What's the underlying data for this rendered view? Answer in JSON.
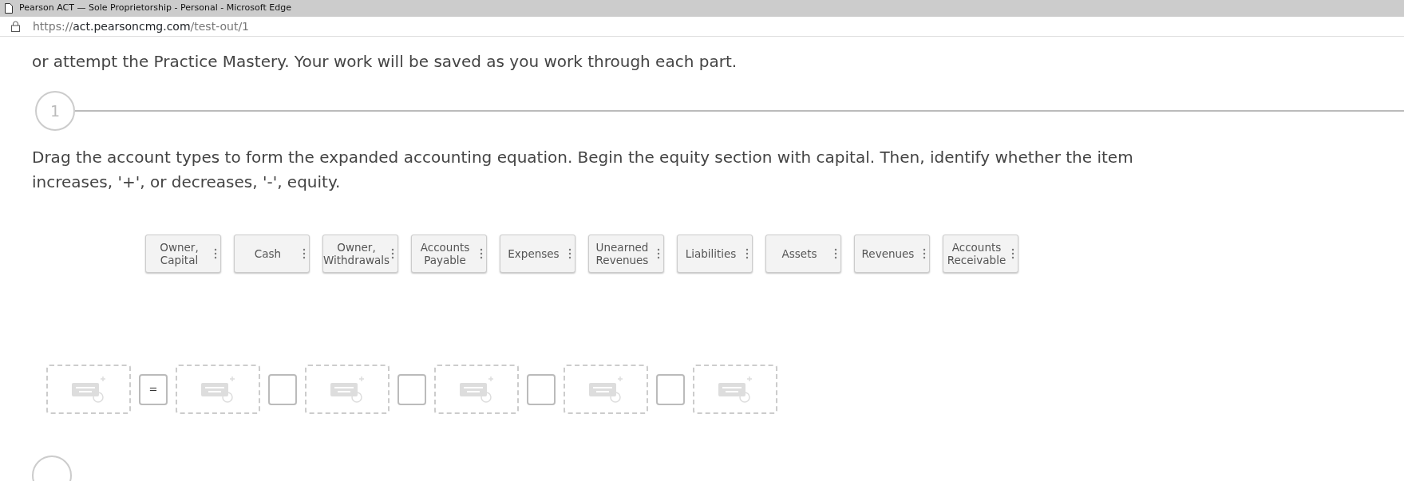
{
  "window": {
    "title": "Pearson ACT — Sole Proprietorship - Personal - Microsoft Edge"
  },
  "address_bar": {
    "scheme": "https://",
    "host": "act.pearsoncmg.com",
    "path": "/test-out/1"
  },
  "intro": "or attempt the Practice Mastery. Your work will be saved as you work through each part.",
  "step": {
    "number": "1",
    "question": "Drag the account types to form the expanded accounting equation. Begin the equity section with capital. Then, identify whether the item increases, '+', or decreases, '-', equity."
  },
  "choices": [
    {
      "label": "Owner, Capital"
    },
    {
      "label": "Cash"
    },
    {
      "label": "Owner, Withdrawals"
    },
    {
      "label": "Accounts Payable"
    },
    {
      "label": "Expenses"
    },
    {
      "label": "Unearned Revenues"
    },
    {
      "label": "Liabilities"
    },
    {
      "label": "Assets"
    },
    {
      "label": "Revenues"
    },
    {
      "label": "Accounts Receivable"
    }
  ],
  "equation": [
    {
      "kind": "drop"
    },
    {
      "kind": "operator",
      "value": "="
    },
    {
      "kind": "drop"
    },
    {
      "kind": "operator"
    },
    {
      "kind": "drop"
    },
    {
      "kind": "operator"
    },
    {
      "kind": "drop"
    },
    {
      "kind": "operator"
    },
    {
      "kind": "drop"
    },
    {
      "kind": "operator"
    },
    {
      "kind": "drop"
    }
  ]
}
